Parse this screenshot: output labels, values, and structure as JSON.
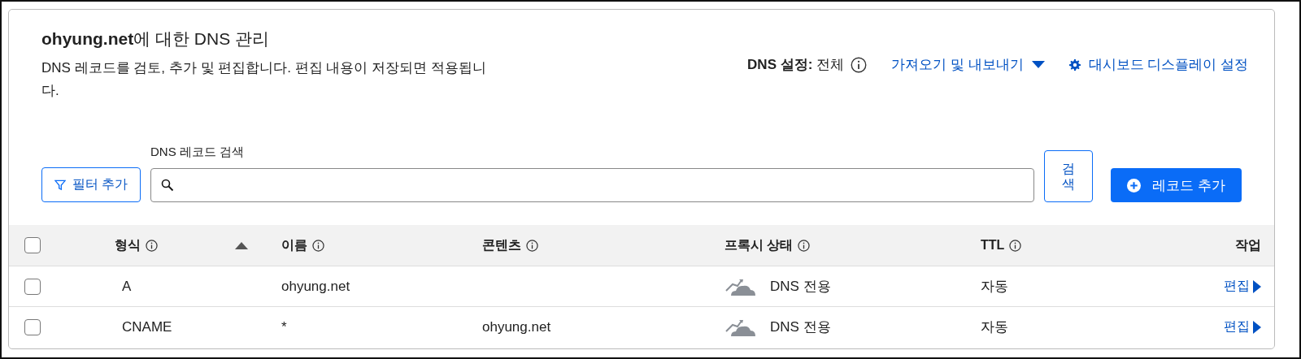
{
  "header": {
    "title": "**ohyung.net**에 대한 DNS 관리",
    "description": "DNS 레코드를 검토, 추가 및 편집합니다. 편집 내용이 저장되면 적용됩니다.",
    "dns_setting": "**DNS 설정:** 전체",
    "import_export": "가져오기 및 내보내기",
    "dashboard_settings": "대시보드 디스플레이 설정"
  },
  "toolbar": {
    "filter_button": "필터 추가",
    "search_label": "DNS 레코드 검색",
    "search_button": "검색",
    "add_button": "레코드 추가"
  },
  "table": {
    "select_all": {
      "checked": false
    },
    "sort_ascending": true,
    "columns": [
      {
        "label": "형식",
        "info": true
      },
      {
        "label": "이름",
        "info": true
      },
      {
        "label": "콘텐츠",
        "info": true
      },
      {
        "label": "프록시 상태",
        "info": true
      },
      {
        "label": "TTL",
        "info": true
      },
      {
        "label": "작업",
        "info": false
      }
    ],
    "rows": [
      {
        "checked": false,
        "type": "A",
        "name": "ohyung.net",
        "proxy": "DNS 전용",
        "ttl": "자동",
        "action": "편집"
      },
      {
        "checked": false,
        "type": "CNAME",
        "name": "*",
        "content": "ohyung.net",
        "proxy": "DNS 전용",
        "ttl": "자동",
        "action": "편집"
      }
    ]
  }
}
